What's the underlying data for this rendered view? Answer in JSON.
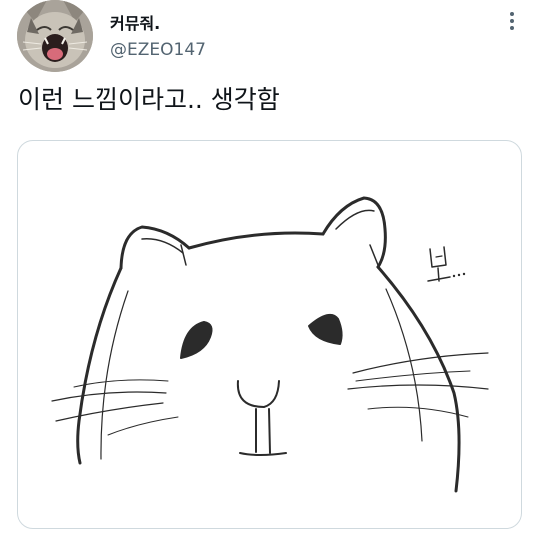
{
  "tweet": {
    "author": {
      "display_name": "커뮤줘.",
      "handle": "@EZEO147",
      "avatar_icon": "yawning-cat-avatar"
    },
    "more_icon": "more-vertical-icon",
    "text": "이런 느낌이라고.. 생각함",
    "media": {
      "image_icon": "hamster-sketch-image",
      "handwritten_text": "보..."
    }
  },
  "colors": {
    "text_primary": "#0f1419",
    "text_secondary": "#536471",
    "card_border": "#cfd9de"
  }
}
